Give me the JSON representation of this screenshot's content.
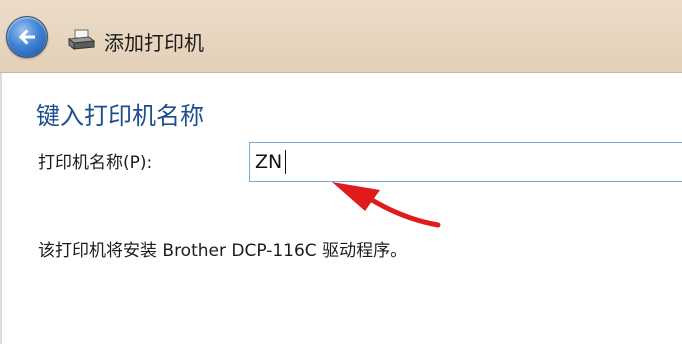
{
  "window": {
    "title": "添加打印机"
  },
  "page": {
    "heading": "键入打印机名称",
    "printer_name": {
      "label": "打印机名称(P):",
      "value": "ZN"
    },
    "driver_info": "该打印机将安装 Brother DCP-116C 驱动程序。"
  },
  "icons": {
    "back": "back-arrow-icon",
    "printer": "printer-icon",
    "annotation": "red-arrow-annotation"
  },
  "colors": {
    "heading": "#1f4e8c",
    "titlebar": "#e3d0b9",
    "input_border": "#7aa7d6",
    "annotation_arrow": "#e01b1b"
  }
}
